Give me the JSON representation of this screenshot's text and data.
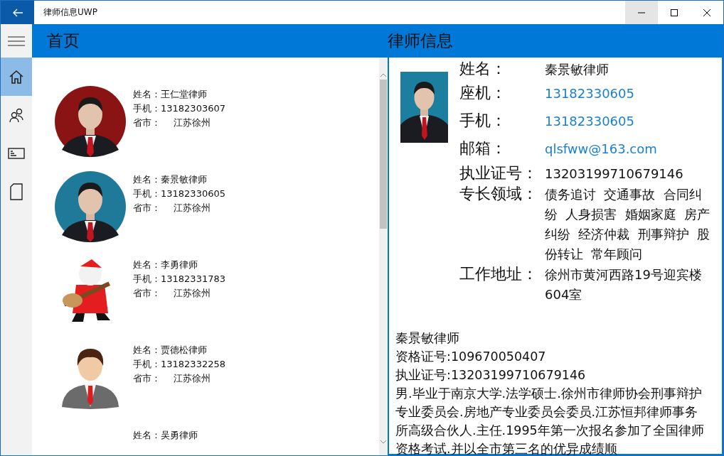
{
  "window": {
    "title": "律师信息UWP"
  },
  "nav": [
    {
      "selected": true
    },
    {
      "selected": false
    },
    {
      "selected": false
    },
    {
      "selected": false
    }
  ],
  "list_header": "首页",
  "detail_header": "律师信息",
  "lawyers": [
    {
      "name": "姓名：王仁堂律师",
      "phone": "手机：13182303607",
      "province_label": "省市：",
      "province": "江苏徐州"
    },
    {
      "name": "姓名：秦景敏律师",
      "phone": "手机：13182330605",
      "province_label": "省市：",
      "province": "江苏徐州"
    },
    {
      "name": "姓名：李勇律师",
      "phone": "手机：13182331783",
      "province_label": "省市：",
      "province": "江苏徐州"
    },
    {
      "name": "姓名：贾德松律师",
      "phone": "手机：13182332258",
      "province_label": "省市：",
      "province": "江苏徐州"
    },
    {
      "name": "姓名：吴勇律师"
    }
  ],
  "detail": {
    "fields": [
      {
        "label": "姓名：",
        "value": "秦景敏律师",
        "kind": "text"
      },
      {
        "label": "座机：",
        "value": "13182330605",
        "kind": "link"
      },
      {
        "label": "手机：",
        "value": "13182330605",
        "kind": "link"
      },
      {
        "label": "邮箱：",
        "value": "qlsfww@163.com",
        "kind": "link"
      },
      {
        "label": "执业证号：",
        "value": "13203199710679146",
        "kind": "text"
      },
      {
        "label": "专长领域：",
        "value": "债务追讨  交通事故  合同纠纷  人身损害  婚姻家庭  房产纠纷  经济仲裁  刑事辩护  股份转让  常年顾问",
        "kind": "text"
      },
      {
        "label": "工作地址：",
        "value": "徐州市黄河西路19号迎宾楼604室",
        "kind": "text"
      }
    ],
    "bio_lines": [
      "秦景敏律师",
      "资格证号:109670050407",
      "执业证号:13203199710679146"
    ],
    "bio": "男.毕业于南京大学.法学硕士.徐州市律师协会刑事辩护专业委员会.房地产专业委员会委员.江苏恒邦律师事务所高级合伙人.主任.1995年第一次报名参加了全国律师资格考试.并以全市第三名的优异成绩顺"
  }
}
